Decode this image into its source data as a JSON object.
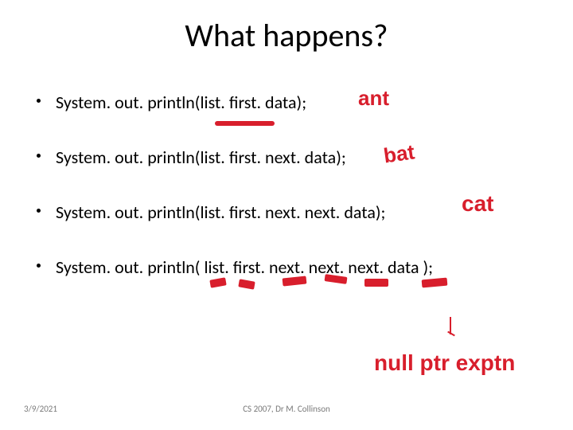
{
  "title": "What happens?",
  "bullets": [
    "System. out. println(list. first. data);",
    " System. out. println(list. first. next. data);",
    " System. out. println(list. first. next. next. data);",
    "System. out. println( list. first. next. next. next. data );"
  ],
  "annotations": {
    "ant": "ant",
    "bat": "bat",
    "cat": "cat",
    "null": "null ptr exptn"
  },
  "footer": {
    "date": "3/9/2021",
    "course": "CS 2007,  Dr M. Collinson"
  }
}
